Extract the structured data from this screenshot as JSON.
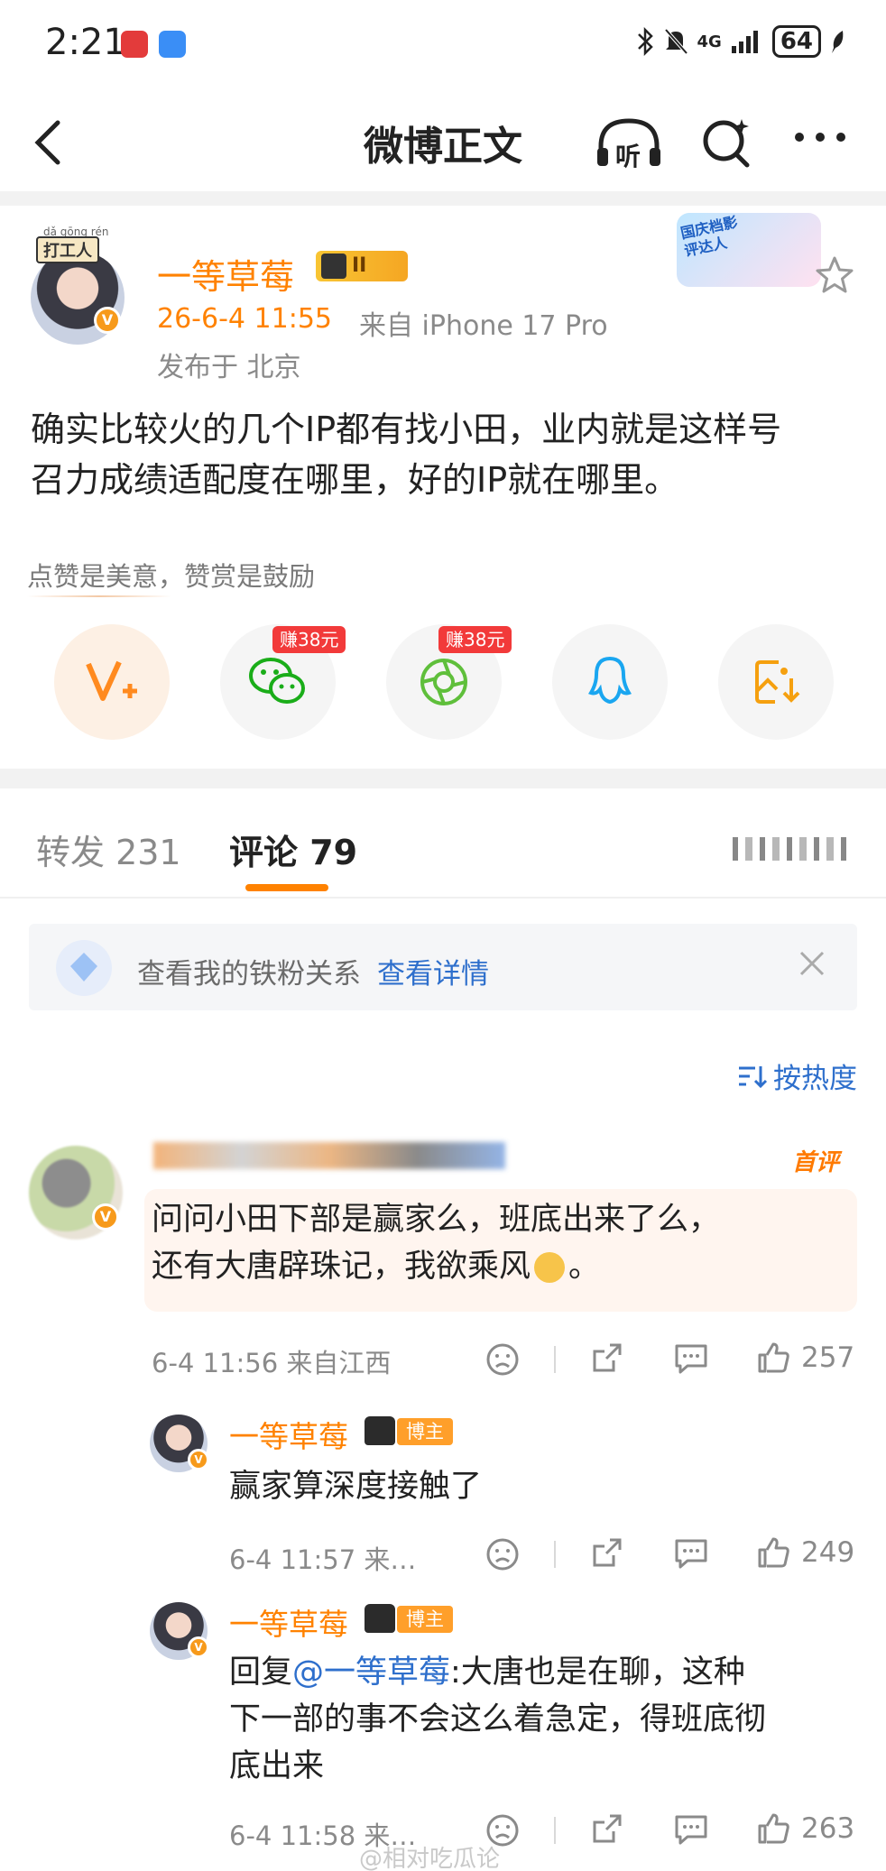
{
  "status_bar": {
    "time": "2:21",
    "network": "4G",
    "battery": "64"
  },
  "nav": {
    "title": "微博正文",
    "listen_label": "听"
  },
  "post": {
    "author": "一等草莓",
    "author_rank": "II",
    "worker_tag": "打工人",
    "worker_pinyin": "dǎ gōng rén",
    "time": "26-6-4 11:55",
    "source": "来自 iPhone 17 Pro",
    "location": "发布于 北京",
    "event_badge": "国庆档影评达人",
    "text_line1": "确实比较火的几个IP都有找小田，业内就是这样号",
    "text_line2": "召力成绩适配度在哪里，好的IP就在哪里。"
  },
  "reward": {
    "hint": "点赞是美意，赞赏是鼓励",
    "earn_tag_1": "赚38元",
    "earn_tag_2": "赚38元"
  },
  "tabs": {
    "repost": "转发 231",
    "comment": "评论 79"
  },
  "fan_box": {
    "text": "查看我的铁粉关系",
    "link": "查看详情"
  },
  "sort": {
    "label": "按热度"
  },
  "comments": [
    {
      "first_tag": "首评",
      "line1": "问问小田下部是赢家么，班底出来了么，",
      "line2": "还有大唐辟珠记，我欲乘风",
      "line2_end": "。",
      "time": "6-4 11:56 来自江西",
      "likes": "257"
    }
  ],
  "replies": [
    {
      "name": "一等草莓",
      "tag": "博主",
      "text": "赢家算深度接触了",
      "time": "6-4 11:57 来…",
      "likes": "249"
    },
    {
      "name": "一等草莓",
      "tag": "博主",
      "reply_prefix": "回复",
      "mention": "@一等草莓",
      "text_line1": ":大唐也是在聊，这种",
      "text_line2": "下一部的事不会这么着急定，得班底彻",
      "text_line3": "底出来",
      "time": "6-4 11:58 来…",
      "likes": "263"
    }
  ],
  "watermark": "@相对吃瓜论",
  "colors": {
    "accent_orange": "#ff8200",
    "link_blue": "#2e6fcc",
    "text_gray": "#8a8a8a"
  }
}
